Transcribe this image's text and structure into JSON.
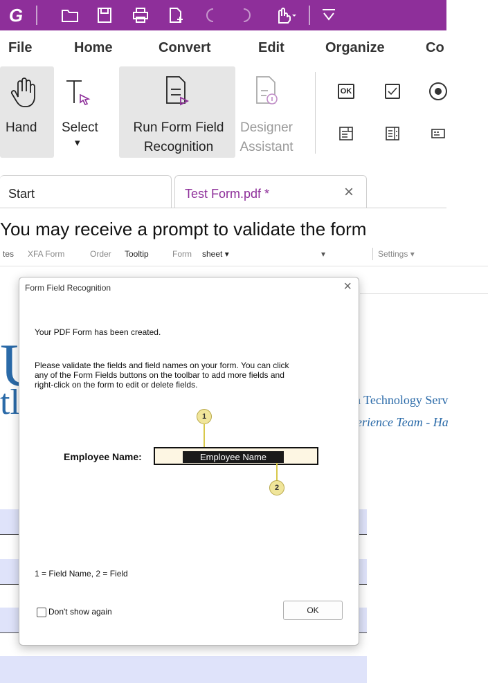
{
  "qab": {
    "icons": [
      "app-logo-icon",
      "open-folder-icon",
      "save-icon",
      "print-icon",
      "new-page-icon",
      "undo-icon",
      "redo-icon",
      "hand-pointer-icon",
      "customize-icon"
    ]
  },
  "menu": {
    "items": [
      "File",
      "Home",
      "Convert",
      "Edit",
      "Organize",
      "Co"
    ]
  },
  "ribbon": {
    "hand": "Hand",
    "select": "Select",
    "select_arrow": "▾",
    "run1": "Run Form Field",
    "run2": "Recognition",
    "designer1": "Designer",
    "designer2": "Assistant",
    "ok_icon_text": "OK"
  },
  "tabs": {
    "start": "Start",
    "test_form": "Test Form.pdf *",
    "close": "×"
  },
  "caption": "You may receive a prompt to validate the form",
  "strip": {
    "items": [
      "tes",
      "XFA Form",
      "Order",
      "Tooltip",
      "Form",
      "sheet ▾",
      "Settings ▾"
    ]
  },
  "document": {
    "big_letter": "U",
    "big_letter2": "tl",
    "org": "ion Technology Serv",
    "team": "xperience Team - Ha"
  },
  "dialog": {
    "title": "Form Field Recognition",
    "close": "×",
    "created": "Your PDF Form has been created.",
    "validate_lines": [
      "Please validate the fields and field names on your form. You can click",
      "any of the Form Fields buttons on the toolbar to add more fields and",
      "right-click on the form to edit or delete fields."
    ],
    "employee_label": "Employee Name:",
    "field_name": "Employee Name",
    "marker1": "1",
    "marker2": "2",
    "legend": "1 = Field Name, 2 = Field",
    "dont_show": "Don't show again",
    "ok": "OK"
  },
  "colors": {
    "qab_bg": "#8e2f9a",
    "doc_blue": "#2a6aa8",
    "band": "#dfe3fa"
  }
}
